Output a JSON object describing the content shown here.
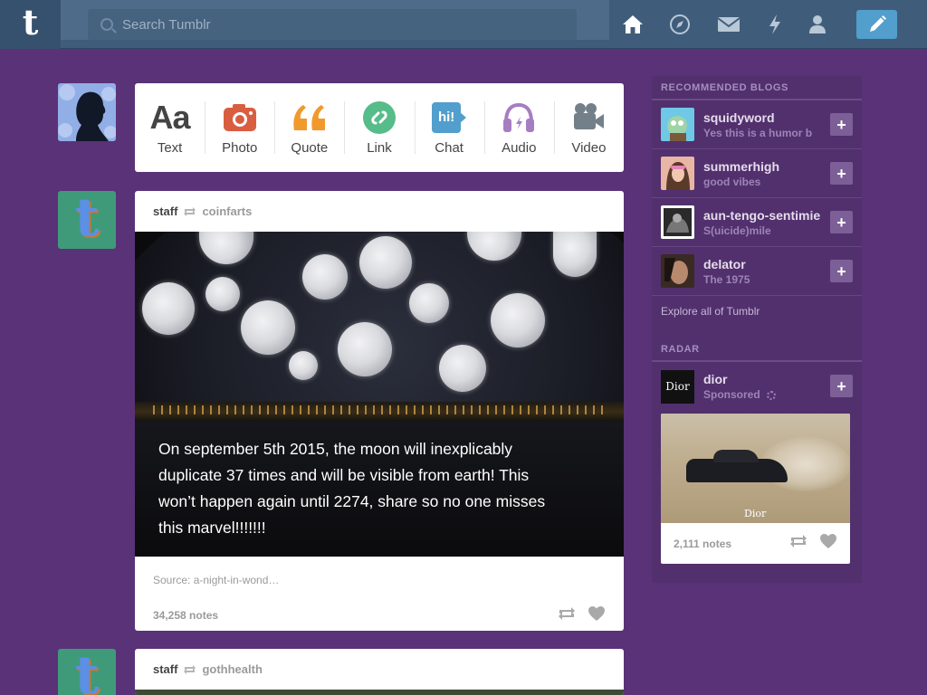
{
  "header": {
    "logo_letter": "t",
    "search_placeholder": "Search Tumblr",
    "nav_icons": [
      "home-icon",
      "explore-icon",
      "messages-icon",
      "activity-icon",
      "account-icon"
    ],
    "compose_icon": "pencil-icon"
  },
  "post_types": [
    {
      "label": "Text",
      "icon_text": "Aa",
      "color": "#444444"
    },
    {
      "label": "Photo",
      "icon": "camera-icon",
      "color": "#d95e40"
    },
    {
      "label": "Quote",
      "icon_text": "““",
      "color": "#f2992e"
    },
    {
      "label": "Link",
      "icon": "link-icon",
      "color": "#56bc8a"
    },
    {
      "label": "Chat",
      "icon_text": "hi!",
      "color": "#529ecc"
    },
    {
      "label": "Audio",
      "icon": "headphones-icon",
      "color": "#a77dc2"
    },
    {
      "label": "Video",
      "icon": "video-camera-icon",
      "color": "#748089"
    }
  ],
  "posts": [
    {
      "author": "staff",
      "reblogged_from": "coinfarts",
      "caption": "On september 5th 2015, the moon will inexplicably duplicate 37 times and will be visible from earth! This won’t happen again until 2274, share so no one misses this marvel!!!!!!!",
      "source": "Source: a-night-in-wond…",
      "notes": "34,258 notes"
    },
    {
      "author": "staff",
      "reblogged_from": "gothhealth"
    }
  ],
  "sidebar": {
    "recommended_title": "RECOMMENDED BLOGS",
    "blogs": [
      {
        "name": "squidyword",
        "subtitle": "Yes this is a humor b"
      },
      {
        "name": "summerhigh",
        "subtitle": "good vibes"
      },
      {
        "name": "aun-tengo-sentimie",
        "subtitle": "S(uicide)mile"
      },
      {
        "name": "delator",
        "subtitle": "The 1975"
      }
    ],
    "follow_symbol": "+",
    "explore_link": "Explore all of Tumblr",
    "radar_title": "RADAR",
    "radar": {
      "name": "dior",
      "subtitle": "Sponsored",
      "logo_text": "Dior",
      "image_mark": "Dior",
      "notes": "2,111 notes"
    }
  },
  "colors": {
    "background": "#5a3277",
    "header": "#3f5d7b",
    "compose": "#529ecc",
    "sidebar": "#52306d"
  }
}
